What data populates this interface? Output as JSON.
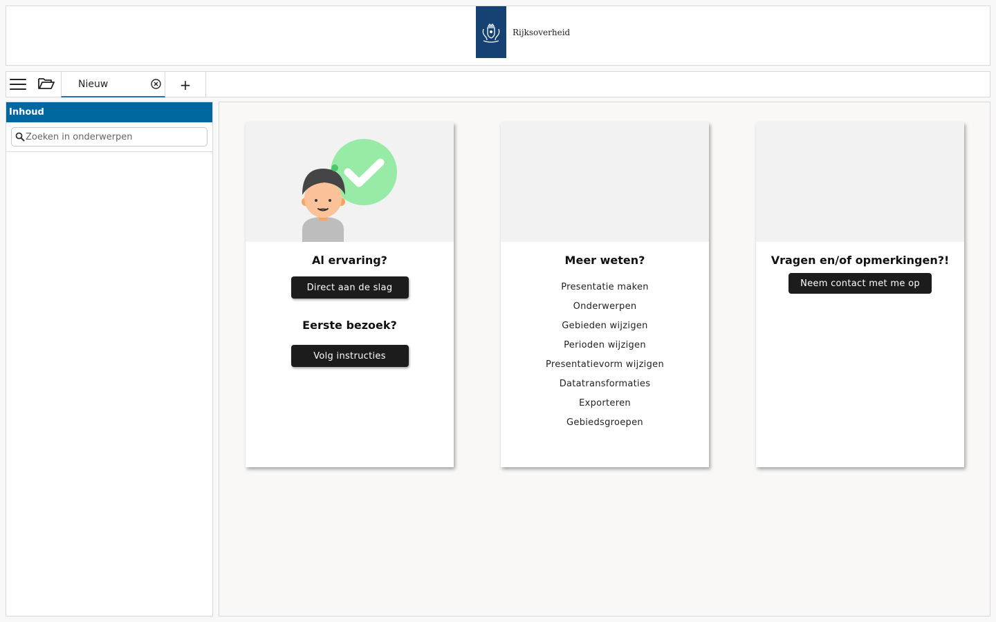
{
  "header": {
    "brand": "Rijksoverheid",
    "logo_color": "#154273"
  },
  "tabbar": {
    "menu_icon": "menu-icon",
    "folder_icon": "folder-open-icon",
    "tabs": [
      {
        "label": "Nieuw",
        "active": true
      }
    ],
    "add_label": "+"
  },
  "sidebar": {
    "title": "Inhoud",
    "search_placeholder": "Zoeken in onderwerpen",
    "accent": "#0067a0"
  },
  "cards": {
    "experience": {
      "heading1": "Al ervaring?",
      "button1": "Direct aan de slag",
      "heading2": "Eerste bezoek?",
      "button2": "Volg instructies"
    },
    "more": {
      "heading": "Meer weten?",
      "links": [
        "Presentatie maken",
        "Onderwerpen",
        "Gebieden wijzigen",
        "Perioden wijzigen",
        "Presentatievorm wijzigen",
        "Datatransformaties",
        "Exporteren",
        "Gebiedsgroepen"
      ]
    },
    "contact": {
      "heading": "Vragen en/of opmerkingen?!",
      "button": "Neem contact met me op"
    }
  }
}
